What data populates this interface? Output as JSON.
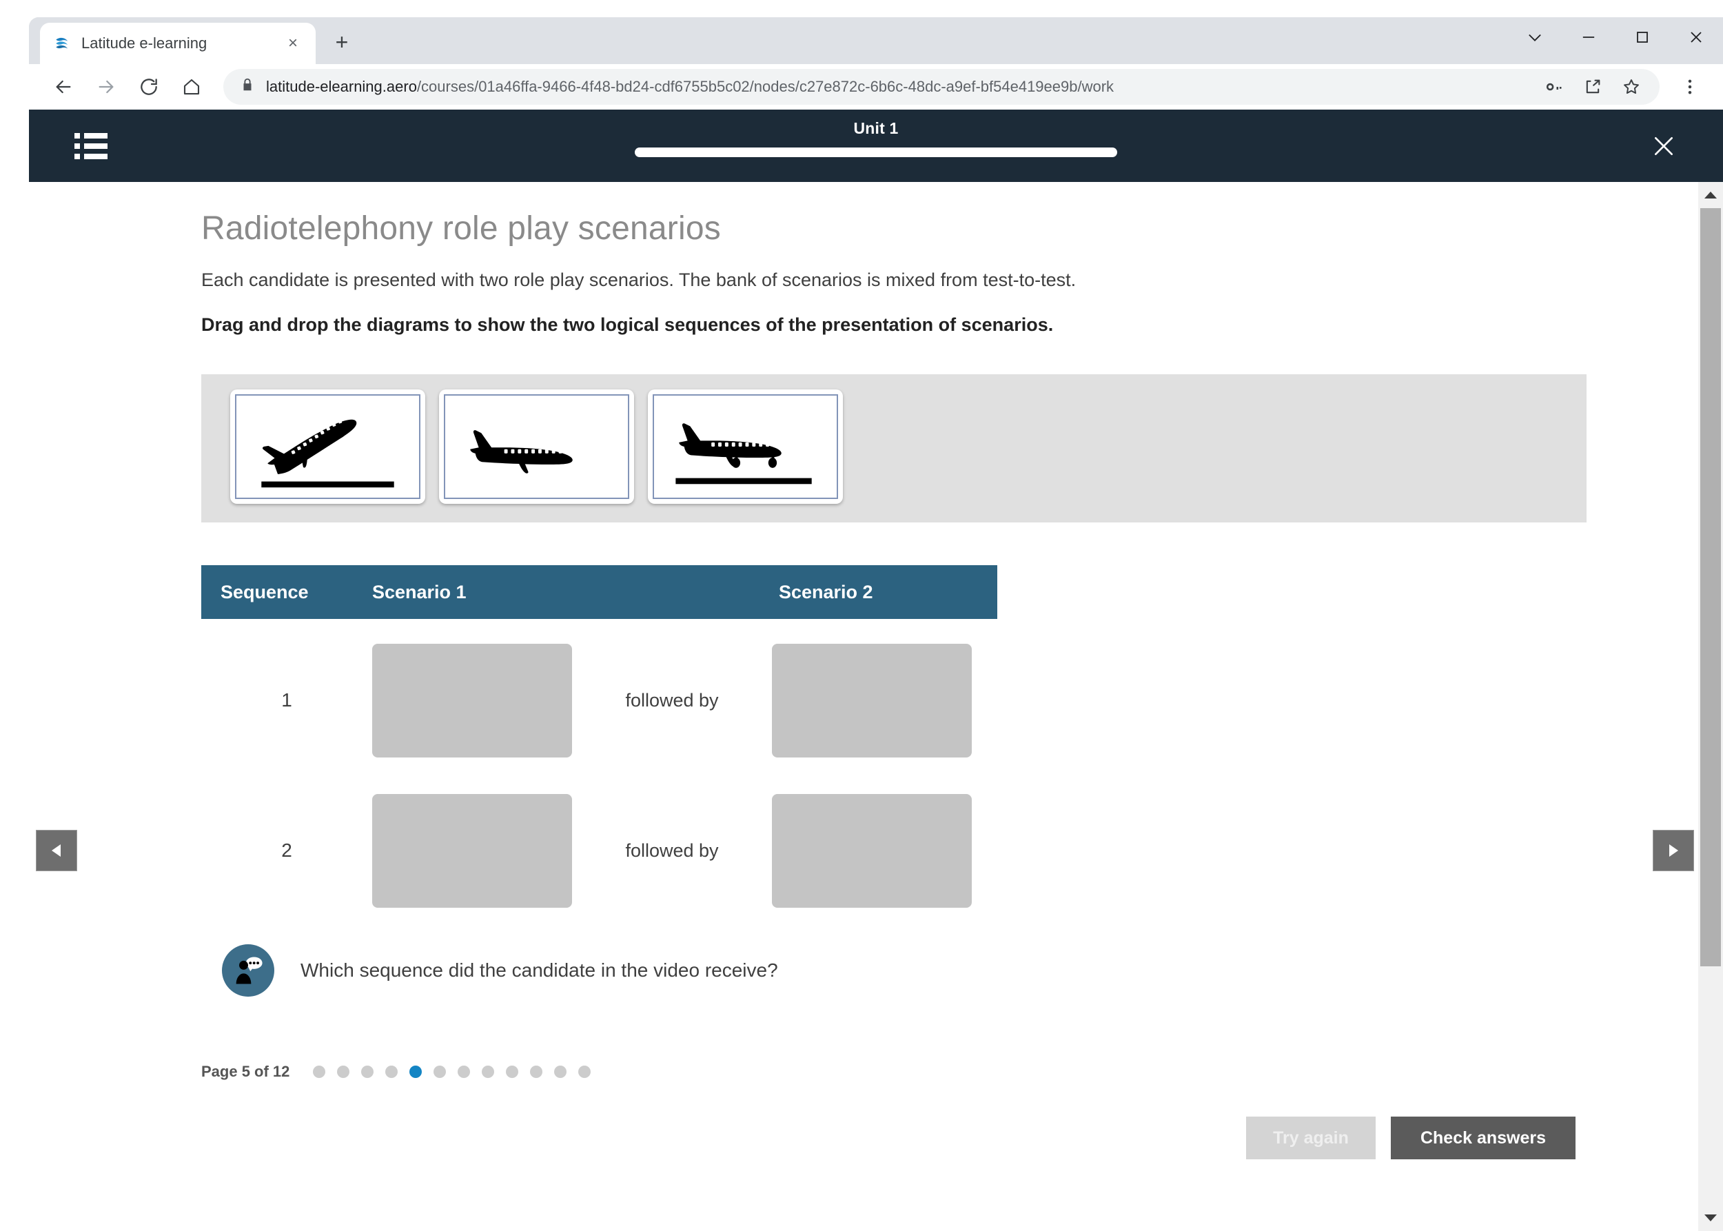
{
  "browser": {
    "tab": {
      "title": "Latitude e-learning",
      "favicon": "latitude-logo-icon",
      "close_label": "×"
    },
    "new_tab_label": "+",
    "window_controls": {
      "chevron": "chevron-down-icon",
      "minimize": "minimize-icon",
      "maximize": "maximize-icon",
      "close": "close-icon"
    },
    "nav": {
      "back": "←",
      "forward": "→",
      "reload": "C",
      "home": "home-icon"
    },
    "omnibox": {
      "lock": "lock-icon",
      "host": "latitude-elearning.aero",
      "path": "/courses/01a46ffa-9466-4f48-bd24-cdf6755b5c02/nodes/c27e872c-6b6c-48dc-a9ef-bf54e419ee9b/work",
      "actions": [
        "key-icon",
        "share-icon",
        "bookmark-star-icon"
      ]
    },
    "menu": "three-dot-menu-icon"
  },
  "app_header": {
    "menu_icon": "list-menu-icon",
    "unit_title": "Unit 1",
    "progress_percent": 100,
    "close_icon": "close-icon"
  },
  "lesson": {
    "title": "Radiotelephony role play scenarios",
    "lead": "Each candidate is presented with two role play scenarios. The bank of scenarios is mixed from test-to-test.",
    "instruction": "Drag and drop the diagrams to show the two logical sequences of the presentation of scenarios."
  },
  "drag_tray": {
    "cards": [
      {
        "name": "aircraft-takeoff-card",
        "diagram": "takeoff",
        "has_runway": true
      },
      {
        "name": "aircraft-cruise-card",
        "diagram": "cruise",
        "has_runway": false
      },
      {
        "name": "aircraft-landing-card",
        "diagram": "landing",
        "has_runway": true
      }
    ]
  },
  "sequence_table": {
    "headers": {
      "sequence": "Sequence",
      "scenario1": "Scenario 1",
      "scenario2": "Scenario 2"
    },
    "rows": [
      {
        "number": "1",
        "link_text": "followed by",
        "slot1": "",
        "slot2": ""
      },
      {
        "number": "2",
        "link_text": "followed by",
        "slot1": "",
        "slot2": ""
      }
    ]
  },
  "question": {
    "avatar_icon": "speaking-person-icon",
    "text": "Which sequence did the candidate in the video receive?"
  },
  "pagination": {
    "label": "Page 5 of 12",
    "total": 12,
    "current": 5,
    "active_color": "#1485c4",
    "inactive_color": "#cccccc"
  },
  "footer": {
    "try_again": "Try again",
    "check_answers": "Check answers"
  },
  "side_nav": {
    "prev_icon": "triangle-left-icon",
    "next_icon": "triangle-right-icon"
  },
  "scrollbar": {
    "up_icon": "scroll-up-arrow-icon",
    "down_icon": "scroll-down-arrow-icon"
  },
  "colors": {
    "header_bg": "#1c2b38",
    "table_header_bg": "#2c6280",
    "avatar_bg": "#3d6e8a",
    "tray_bg": "#e0e0e0",
    "dropzone_bg": "#c4c4c4",
    "primary_button_bg": "#5b5b5b"
  }
}
